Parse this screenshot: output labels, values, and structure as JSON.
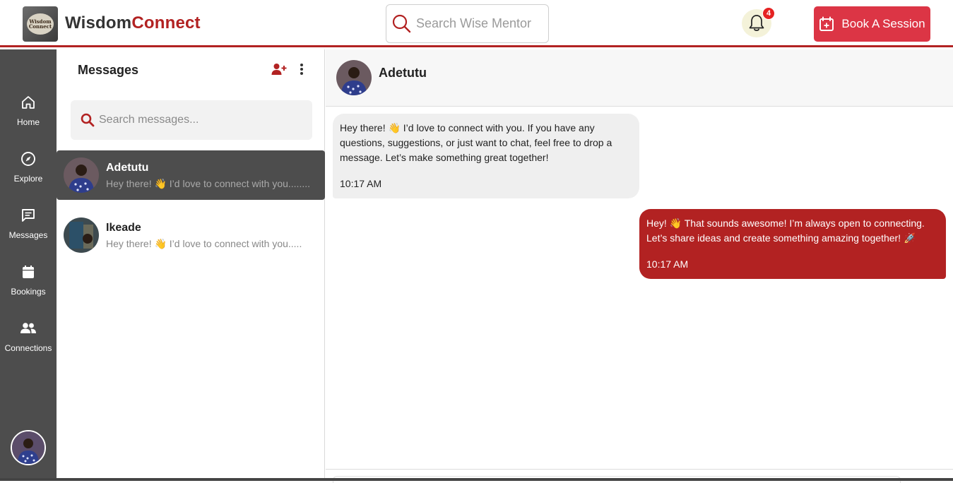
{
  "header": {
    "logo_text": "Wisdom Connect",
    "brand_part1": "Wisdom",
    "brand_part2": "Connect",
    "search_placeholder": "Search Wise Mentor",
    "notification_count": "4",
    "book_button": "Book A Session"
  },
  "colors": {
    "brand_red": "#b22222",
    "button_red": "#dc3545",
    "nav_gray": "#4d4d4d"
  },
  "nav": {
    "items": [
      {
        "label": "Home",
        "icon": "home-icon"
      },
      {
        "label": "Explore",
        "icon": "compass-icon"
      },
      {
        "label": "Messages",
        "icon": "message-icon"
      },
      {
        "label": "Bookings",
        "icon": "calendar-icon"
      },
      {
        "label": "Connections",
        "icon": "users-icon"
      }
    ]
  },
  "messages_panel": {
    "title": "Messages",
    "search_placeholder": "Search messages...",
    "conversations": [
      {
        "name": "Adetutu",
        "preview": "Hey there! 👋 I’d love to connect with you........",
        "active": true
      },
      {
        "name": "Ikeade",
        "preview": "Hey there! 👋 I’d love to connect with you.....",
        "active": false
      }
    ]
  },
  "chat": {
    "contact_name": "Adetutu",
    "messages": [
      {
        "direction": "incoming",
        "text": "Hey there! 👋 I’d love to connect with you. If you have any questions, suggestions, or just want to chat, feel free to drop a message. Let’s make something great together!",
        "time": "10:17 AM"
      },
      {
        "direction": "outgoing",
        "text": "Hey! 👋 That sounds awesome! I’m always open to connecting. Let’s share ideas and create something amazing together! 🚀",
        "time": "10:17 AM"
      }
    ]
  }
}
